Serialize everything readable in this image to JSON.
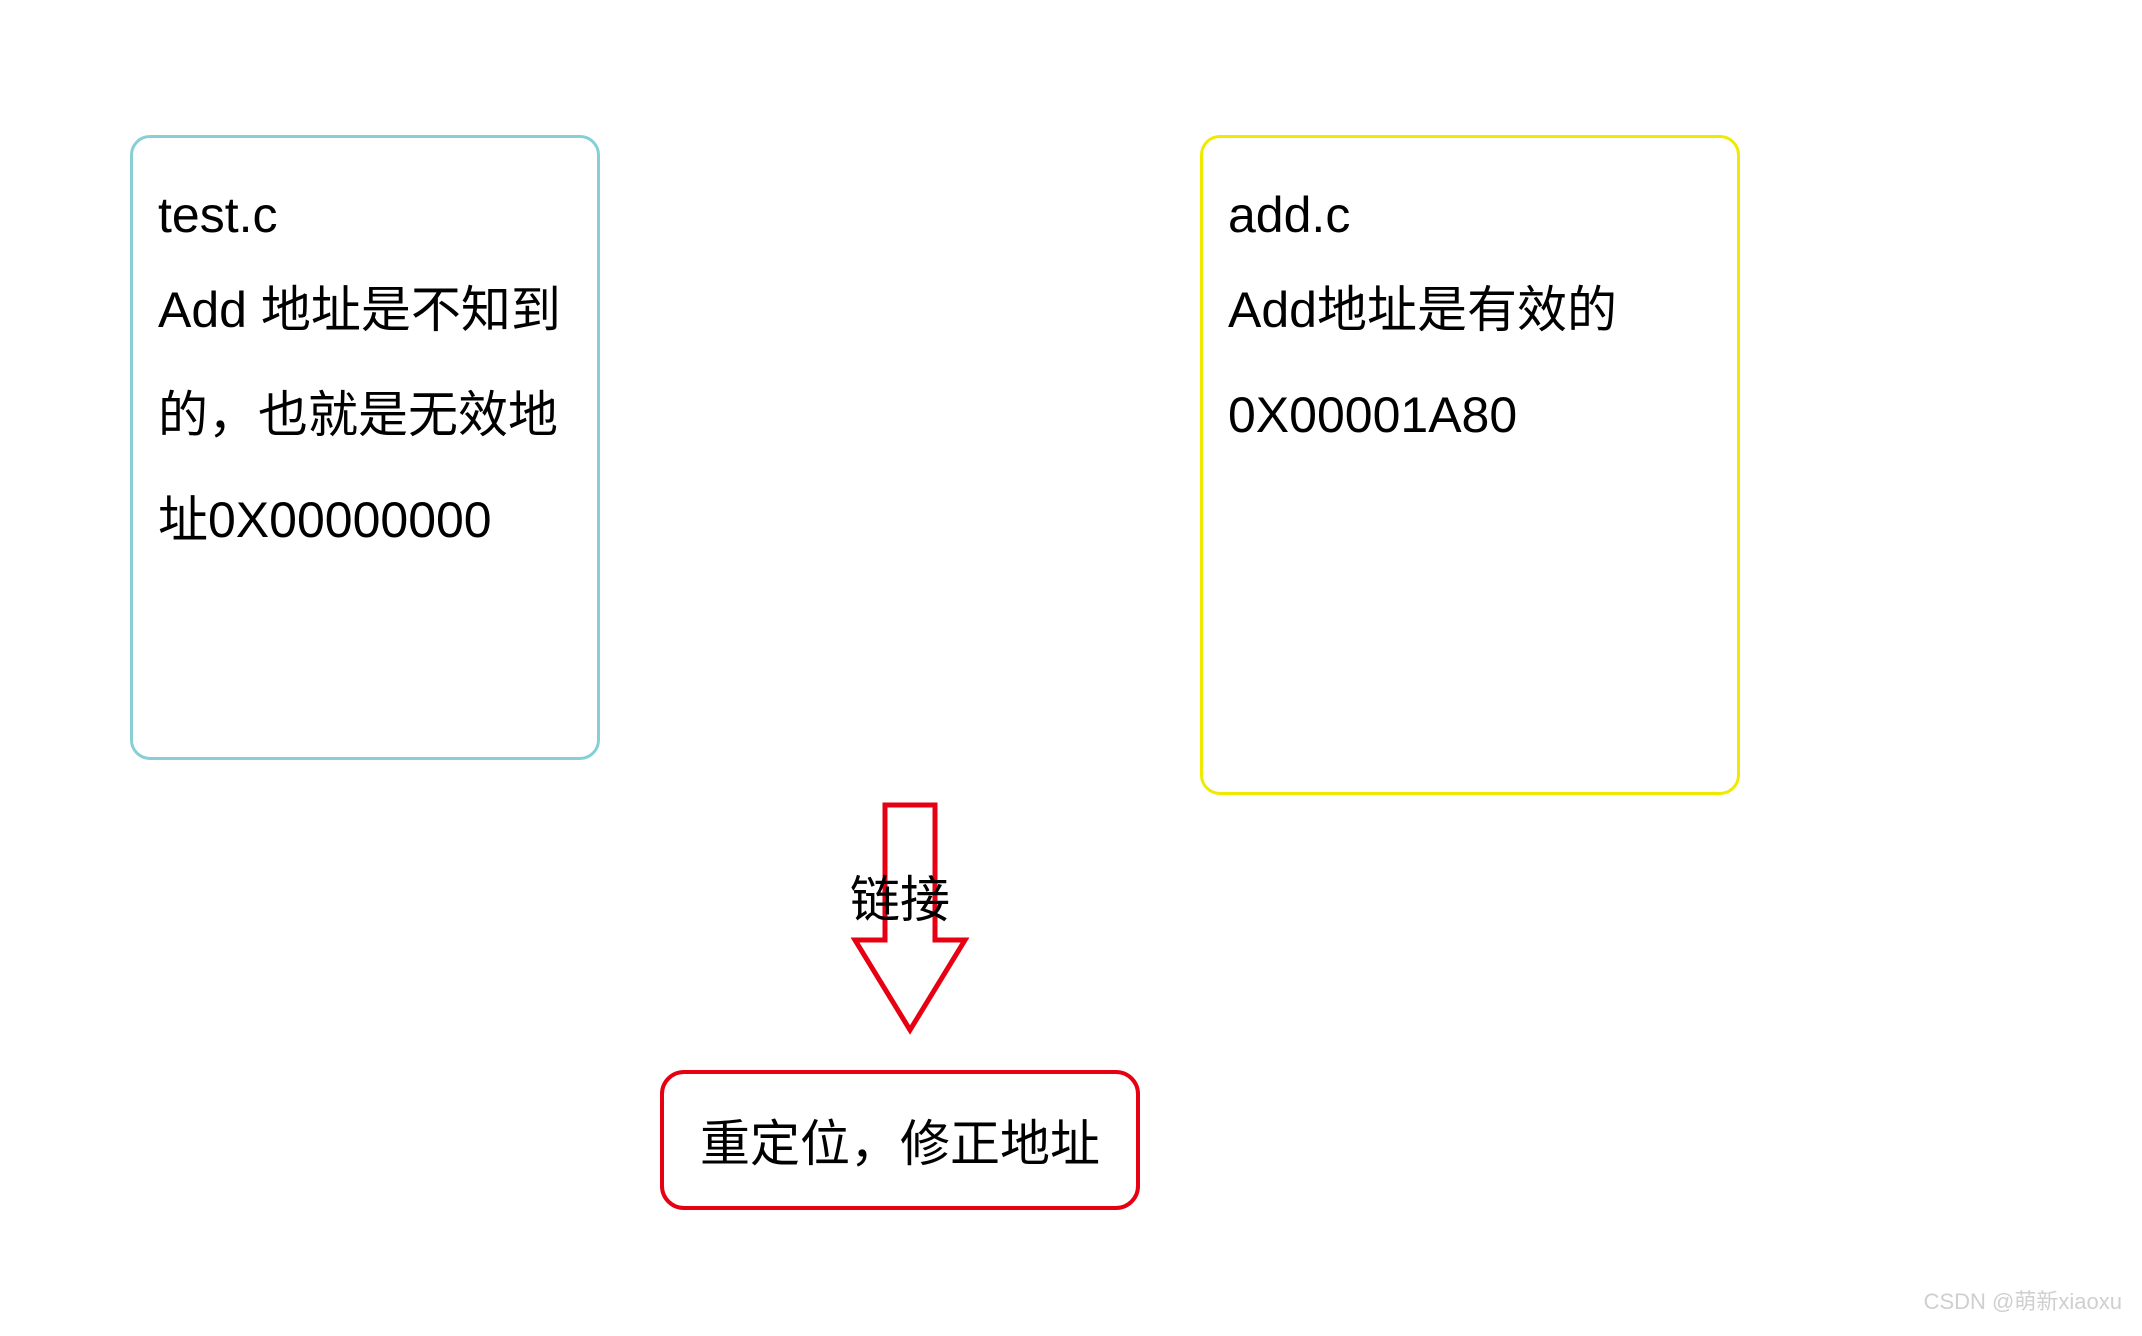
{
  "left_box": {
    "title": "test.c",
    "body": "Add 地址是不知到的，也就是无效地址0X00000000"
  },
  "right_box": {
    "title": "add.c",
    "body": "Add地址是有效的0X00001A80"
  },
  "arrow": {
    "label": "链接"
  },
  "result_box": {
    "text": "重定位，修正地址"
  },
  "watermark": "CSDN @萌新xiaoxu"
}
